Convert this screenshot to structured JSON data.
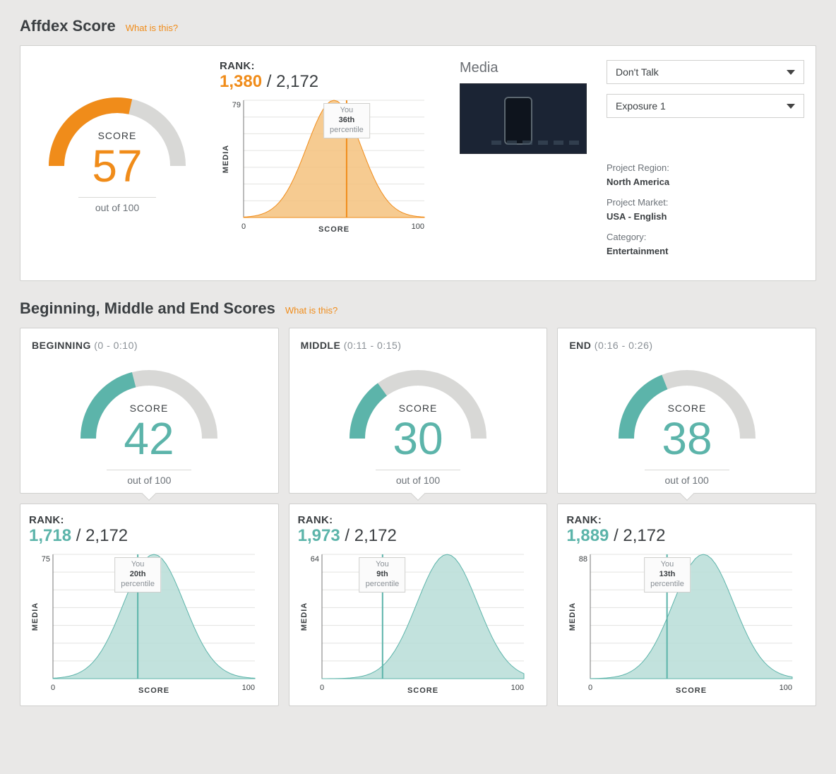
{
  "colors": {
    "orange": "#f08c1a",
    "teal": "#5cb4aa"
  },
  "labels": {
    "score_word": "SCORE",
    "out_of_100": "out of 100",
    "rank_word": "RANK:",
    "axis_media": "MEDIA",
    "axis_score": "SCORE",
    "you": "You",
    "percentile": "percentile",
    "what_is_this": "What is this?"
  },
  "sections": {
    "affdex_title": "Affdex Score",
    "bme_title": "Beginning, Middle and End Scores"
  },
  "affdex": {
    "score": 57,
    "rank": "1,380",
    "rank_total": "2,172",
    "percentile": "36th",
    "dist_peak_y": 79,
    "dist_marker_x": 57
  },
  "media": {
    "heading": "Media",
    "dd1": "Don't Talk",
    "dd2": "Exposure 1",
    "region_label": "Project Region:",
    "region_value": "North America",
    "market_label": "Project Market:",
    "market_value": "USA - English",
    "category_label": "Category:",
    "category_value": "Entertainment"
  },
  "bme": [
    {
      "name": "BEGINNING",
      "range": "(0 - 0:10)",
      "score": 42,
      "rank": "1,718",
      "rank_total": "2,172",
      "percentile": "20th",
      "dist_peak_y": 75,
      "dist_marker_x": 42
    },
    {
      "name": "MIDDLE",
      "range": "(0:11 - 0:15)",
      "score": 30,
      "rank": "1,973",
      "rank_total": "2,172",
      "percentile": "9th",
      "dist_peak_y": 64,
      "dist_marker_x": 30,
      "dist_shift": 12
    },
    {
      "name": "END",
      "range": "(0:16 - 0:26)",
      "score": 38,
      "rank": "1,889",
      "rank_total": "2,172",
      "percentile": "13th",
      "dist_peak_y": 88,
      "dist_marker_x": 38,
      "dist_shift": 6
    }
  ],
  "chart_data": [
    {
      "id": "affdex_gauge",
      "type": "gauge",
      "value": 57,
      "min": 0,
      "max": 100,
      "title": "Affdex Score",
      "color": "#f08c1a"
    },
    {
      "id": "affdex_distribution",
      "type": "area",
      "title": "Affdex score distribution across media",
      "xlabel": "SCORE",
      "ylabel": "MEDIA",
      "xlim": [
        0,
        100
      ],
      "ylim": [
        0,
        79
      ],
      "marker": {
        "x": 57,
        "label": "You — 36th percentile"
      },
      "series": [
        {
          "name": "media density",
          "shape": "bell",
          "mean": 50,
          "sd": 15,
          "peak": 79
        }
      ],
      "color": "#f3b469"
    },
    {
      "id": "bme_beginning_gauge",
      "type": "gauge",
      "value": 42,
      "min": 0,
      "max": 100,
      "color": "#5cb4aa"
    },
    {
      "id": "bme_beginning_distribution",
      "type": "area",
      "xlabel": "SCORE",
      "ylabel": "MEDIA",
      "xlim": [
        0,
        100
      ],
      "ylim": [
        0,
        75
      ],
      "marker": {
        "x": 42,
        "label": "You — 20th percentile"
      },
      "series": [
        {
          "name": "media density",
          "shape": "bell",
          "mean": 50,
          "sd": 15,
          "peak": 75
        }
      ],
      "color": "#a9d6cf"
    },
    {
      "id": "bme_middle_gauge",
      "type": "gauge",
      "value": 30,
      "min": 0,
      "max": 100,
      "color": "#5cb4aa"
    },
    {
      "id": "bme_middle_distribution",
      "type": "area",
      "xlabel": "SCORE",
      "ylabel": "MEDIA",
      "xlim": [
        0,
        100
      ],
      "ylim": [
        0,
        64
      ],
      "marker": {
        "x": 30,
        "label": "You — 9th percentile"
      },
      "series": [
        {
          "name": "media density",
          "shape": "bell",
          "mean": 62,
          "sd": 15,
          "peak": 64
        }
      ],
      "color": "#a9d6cf"
    },
    {
      "id": "bme_end_gauge",
      "type": "gauge",
      "value": 38,
      "min": 0,
      "max": 100,
      "color": "#5cb4aa"
    },
    {
      "id": "bme_end_distribution",
      "type": "area",
      "xlabel": "SCORE",
      "ylabel": "MEDIA",
      "xlim": [
        0,
        100
      ],
      "ylim": [
        0,
        88
      ],
      "marker": {
        "x": 38,
        "label": "You — 13th percentile"
      },
      "series": [
        {
          "name": "media density",
          "shape": "bell",
          "mean": 56,
          "sd": 14,
          "peak": 88
        }
      ],
      "color": "#a9d6cf"
    }
  ]
}
